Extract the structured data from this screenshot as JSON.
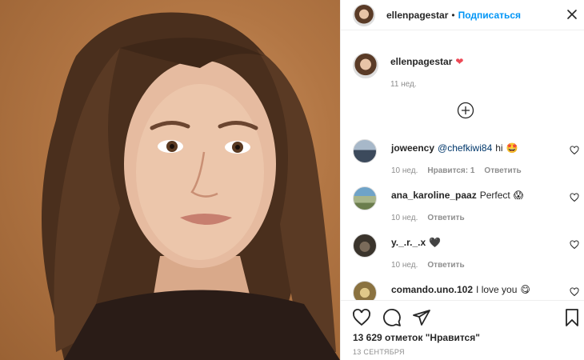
{
  "post": {
    "username": "ellenpagestar",
    "follow_label": "Подписаться",
    "separator": "•",
    "caption_author": "ellenpagestar",
    "caption_emoji": "❤",
    "caption_time": "11 нед.",
    "likes_text": "13 629 отметок \"Нравится\"",
    "date_text": "13 СЕНТЯБРЯ"
  },
  "comments": [
    {
      "author": "joweency",
      "mention": "@chefkiwi84",
      "text": "hi",
      "emoji": "🤩",
      "time": "10 нед.",
      "likes": "Нравится: 1",
      "reply": "Ответить"
    },
    {
      "author": "ana_karoline_paaz",
      "mention": "",
      "text": "Perfect",
      "emoji": "😱",
      "time": "10 нед.",
      "likes": "",
      "reply": "Ответить"
    },
    {
      "author": "y._.r._.x",
      "mention": "",
      "text": "",
      "emoji": "🖤",
      "time": "10 нед.",
      "likes": "",
      "reply": "Ответить"
    },
    {
      "author": "comando.uno.102",
      "mention": "",
      "text": "I love you",
      "emoji": "😋",
      "time": "",
      "likes": "",
      "reply": ""
    }
  ],
  "icons": {
    "more": "close-icon",
    "load_more": "plus-circle-icon",
    "like": "heart-icon",
    "comment": "comment-icon",
    "share": "share-icon",
    "save": "bookmark-icon"
  },
  "colors": {
    "link": "#0095f6",
    "text": "#262626",
    "muted": "#8e8e8e",
    "heart": "#ed4956"
  }
}
